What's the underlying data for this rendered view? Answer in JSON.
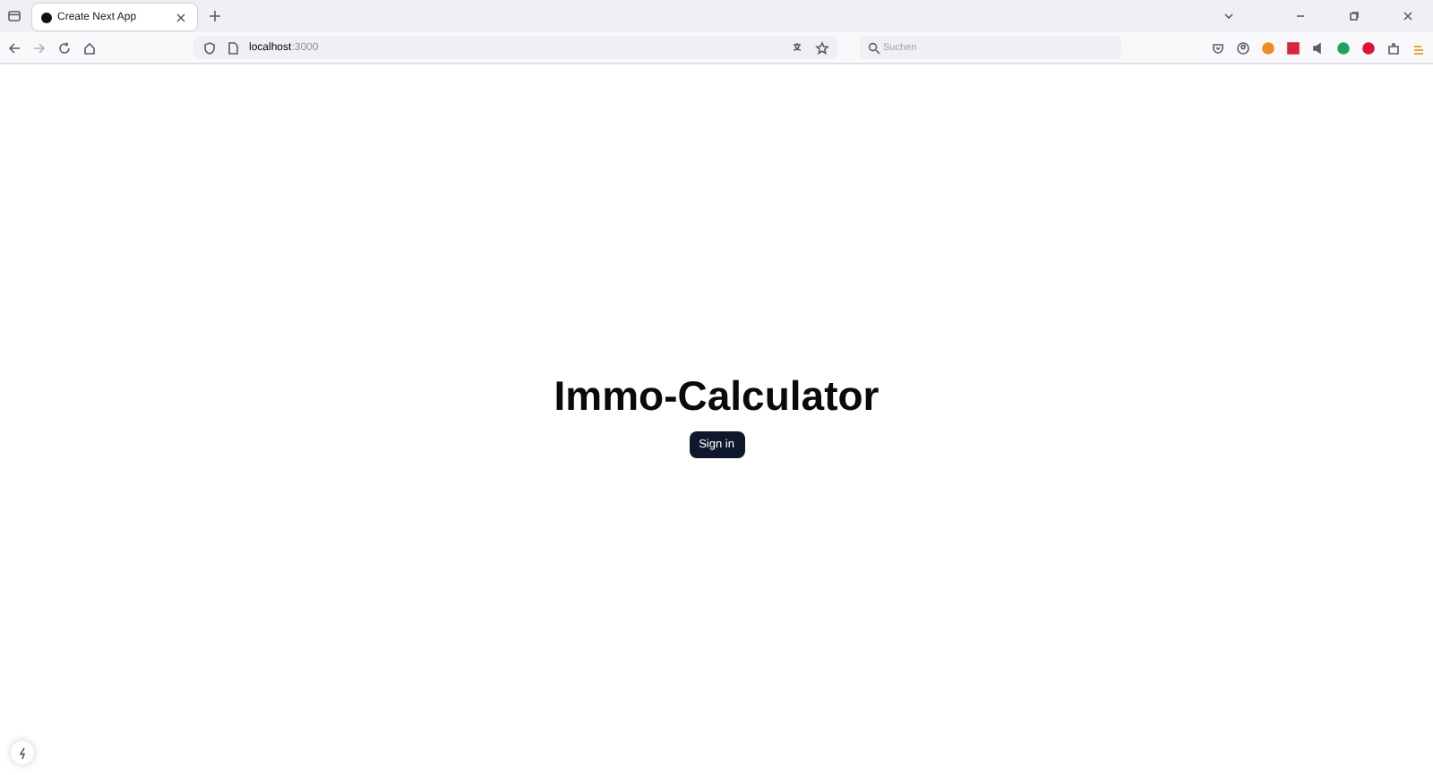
{
  "browser": {
    "tabs": [
      {
        "title": "Create Next App",
        "selected": true
      }
    ],
    "address": {
      "host": "localhost",
      "port": ":3000"
    },
    "search": {
      "placeholder": "Suchen"
    }
  },
  "page": {
    "title": "Immo-Calculator",
    "button": "Sign in"
  }
}
